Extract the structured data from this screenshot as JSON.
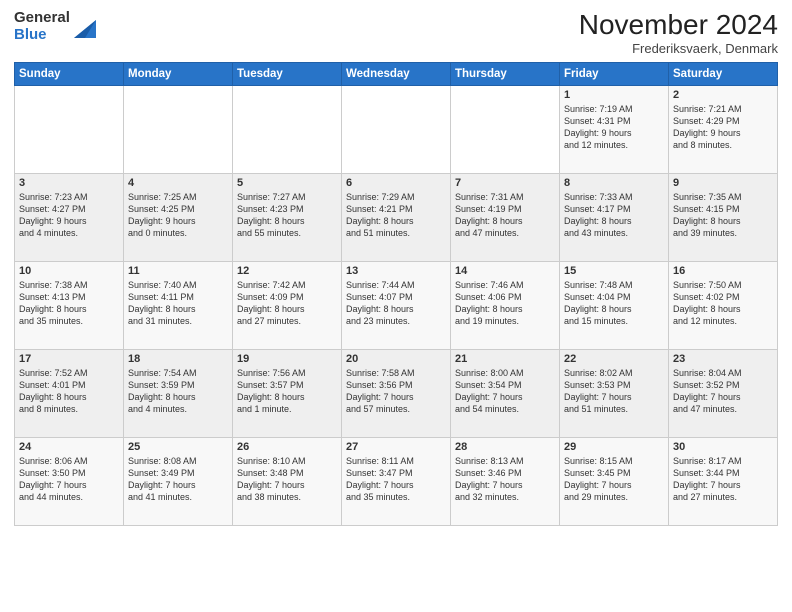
{
  "logo": {
    "general": "General",
    "blue": "Blue"
  },
  "title": "November 2024",
  "subtitle": "Frederiksvaerk, Denmark",
  "days_header": [
    "Sunday",
    "Monday",
    "Tuesday",
    "Wednesday",
    "Thursday",
    "Friday",
    "Saturday"
  ],
  "weeks": [
    [
      {
        "num": "",
        "info": ""
      },
      {
        "num": "",
        "info": ""
      },
      {
        "num": "",
        "info": ""
      },
      {
        "num": "",
        "info": ""
      },
      {
        "num": "",
        "info": ""
      },
      {
        "num": "1",
        "info": "Sunrise: 7:19 AM\nSunset: 4:31 PM\nDaylight: 9 hours\nand 12 minutes."
      },
      {
        "num": "2",
        "info": "Sunrise: 7:21 AM\nSunset: 4:29 PM\nDaylight: 9 hours\nand 8 minutes."
      }
    ],
    [
      {
        "num": "3",
        "info": "Sunrise: 7:23 AM\nSunset: 4:27 PM\nDaylight: 9 hours\nand 4 minutes."
      },
      {
        "num": "4",
        "info": "Sunrise: 7:25 AM\nSunset: 4:25 PM\nDaylight: 9 hours\nand 0 minutes."
      },
      {
        "num": "5",
        "info": "Sunrise: 7:27 AM\nSunset: 4:23 PM\nDaylight: 8 hours\nand 55 minutes."
      },
      {
        "num": "6",
        "info": "Sunrise: 7:29 AM\nSunset: 4:21 PM\nDaylight: 8 hours\nand 51 minutes."
      },
      {
        "num": "7",
        "info": "Sunrise: 7:31 AM\nSunset: 4:19 PM\nDaylight: 8 hours\nand 47 minutes."
      },
      {
        "num": "8",
        "info": "Sunrise: 7:33 AM\nSunset: 4:17 PM\nDaylight: 8 hours\nand 43 minutes."
      },
      {
        "num": "9",
        "info": "Sunrise: 7:35 AM\nSunset: 4:15 PM\nDaylight: 8 hours\nand 39 minutes."
      }
    ],
    [
      {
        "num": "10",
        "info": "Sunrise: 7:38 AM\nSunset: 4:13 PM\nDaylight: 8 hours\nand 35 minutes."
      },
      {
        "num": "11",
        "info": "Sunrise: 7:40 AM\nSunset: 4:11 PM\nDaylight: 8 hours\nand 31 minutes."
      },
      {
        "num": "12",
        "info": "Sunrise: 7:42 AM\nSunset: 4:09 PM\nDaylight: 8 hours\nand 27 minutes."
      },
      {
        "num": "13",
        "info": "Sunrise: 7:44 AM\nSunset: 4:07 PM\nDaylight: 8 hours\nand 23 minutes."
      },
      {
        "num": "14",
        "info": "Sunrise: 7:46 AM\nSunset: 4:06 PM\nDaylight: 8 hours\nand 19 minutes."
      },
      {
        "num": "15",
        "info": "Sunrise: 7:48 AM\nSunset: 4:04 PM\nDaylight: 8 hours\nand 15 minutes."
      },
      {
        "num": "16",
        "info": "Sunrise: 7:50 AM\nSunset: 4:02 PM\nDaylight: 8 hours\nand 12 minutes."
      }
    ],
    [
      {
        "num": "17",
        "info": "Sunrise: 7:52 AM\nSunset: 4:01 PM\nDaylight: 8 hours\nand 8 minutes."
      },
      {
        "num": "18",
        "info": "Sunrise: 7:54 AM\nSunset: 3:59 PM\nDaylight: 8 hours\nand 4 minutes."
      },
      {
        "num": "19",
        "info": "Sunrise: 7:56 AM\nSunset: 3:57 PM\nDaylight: 8 hours\nand 1 minute."
      },
      {
        "num": "20",
        "info": "Sunrise: 7:58 AM\nSunset: 3:56 PM\nDaylight: 7 hours\nand 57 minutes."
      },
      {
        "num": "21",
        "info": "Sunrise: 8:00 AM\nSunset: 3:54 PM\nDaylight: 7 hours\nand 54 minutes."
      },
      {
        "num": "22",
        "info": "Sunrise: 8:02 AM\nSunset: 3:53 PM\nDaylight: 7 hours\nand 51 minutes."
      },
      {
        "num": "23",
        "info": "Sunrise: 8:04 AM\nSunset: 3:52 PM\nDaylight: 7 hours\nand 47 minutes."
      }
    ],
    [
      {
        "num": "24",
        "info": "Sunrise: 8:06 AM\nSunset: 3:50 PM\nDaylight: 7 hours\nand 44 minutes."
      },
      {
        "num": "25",
        "info": "Sunrise: 8:08 AM\nSunset: 3:49 PM\nDaylight: 7 hours\nand 41 minutes."
      },
      {
        "num": "26",
        "info": "Sunrise: 8:10 AM\nSunset: 3:48 PM\nDaylight: 7 hours\nand 38 minutes."
      },
      {
        "num": "27",
        "info": "Sunrise: 8:11 AM\nSunset: 3:47 PM\nDaylight: 7 hours\nand 35 minutes."
      },
      {
        "num": "28",
        "info": "Sunrise: 8:13 AM\nSunset: 3:46 PM\nDaylight: 7 hours\nand 32 minutes."
      },
      {
        "num": "29",
        "info": "Sunrise: 8:15 AM\nSunset: 3:45 PM\nDaylight: 7 hours\nand 29 minutes."
      },
      {
        "num": "30",
        "info": "Sunrise: 8:17 AM\nSunset: 3:44 PM\nDaylight: 7 hours\nand 27 minutes."
      }
    ]
  ]
}
